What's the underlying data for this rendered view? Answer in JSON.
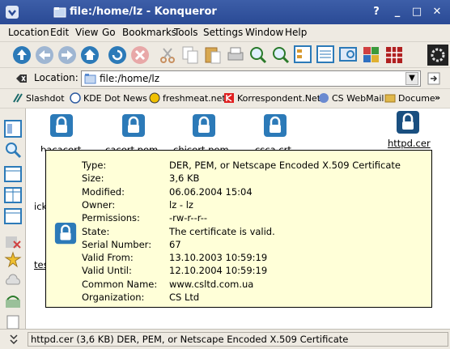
{
  "window": {
    "title": "file:/home/lz - Konqueror"
  },
  "menubar": {
    "items": [
      "Location",
      "Edit",
      "View",
      "Go",
      "Bookmarks",
      "Tools",
      "Settings",
      "Window",
      "Help"
    ]
  },
  "location": {
    "label": "Location:",
    "value": "file:/home/lz"
  },
  "bookmarks": {
    "items": [
      "Slashdot",
      "KDE Dot News",
      "freshmeat.net",
      "Korrespondent.Net",
      "CS WebMail",
      "Docume"
    ]
  },
  "files": [
    "cacert.pem",
    "chicert.pem",
    "csca.crt",
    "httpd.cer"
  ],
  "tooltip": {
    "rows": [
      {
        "label": "Type:",
        "value": "DER, PEM, or Netscape Encoded X.509 Certificate"
      },
      {
        "label": "Size:",
        "value": "3,6 KB"
      },
      {
        "label": "Modified:",
        "value": "06.06.2004 15:04"
      },
      {
        "label": "Owner:",
        "value": "lz - lz"
      },
      {
        "label": "Permissions:",
        "value": "-rw-r--r--"
      },
      {
        "label": "State:",
        "value": "The certificate is valid."
      },
      {
        "label": "Serial Number:",
        "value": "67"
      },
      {
        "label": "Valid From:",
        "value": "13.10.2003 10:59:19"
      },
      {
        "label": "Valid Until:",
        "value": "12.10.2004 10:59:19"
      },
      {
        "label": "Common Name:",
        "value": "www.csltd.com.ua"
      },
      {
        "label": "Organization:",
        "value": "CS Ltd"
      }
    ]
  },
  "status": {
    "text": "httpd.cer (3,6 KB)  DER, PEM, or Netscape Encoded X.509 Certificate"
  },
  "colors": {
    "titlebar": "#2f4f9a",
    "tooltip_bg": "#ffffd8",
    "icon_blue": "#2c7ab8"
  }
}
